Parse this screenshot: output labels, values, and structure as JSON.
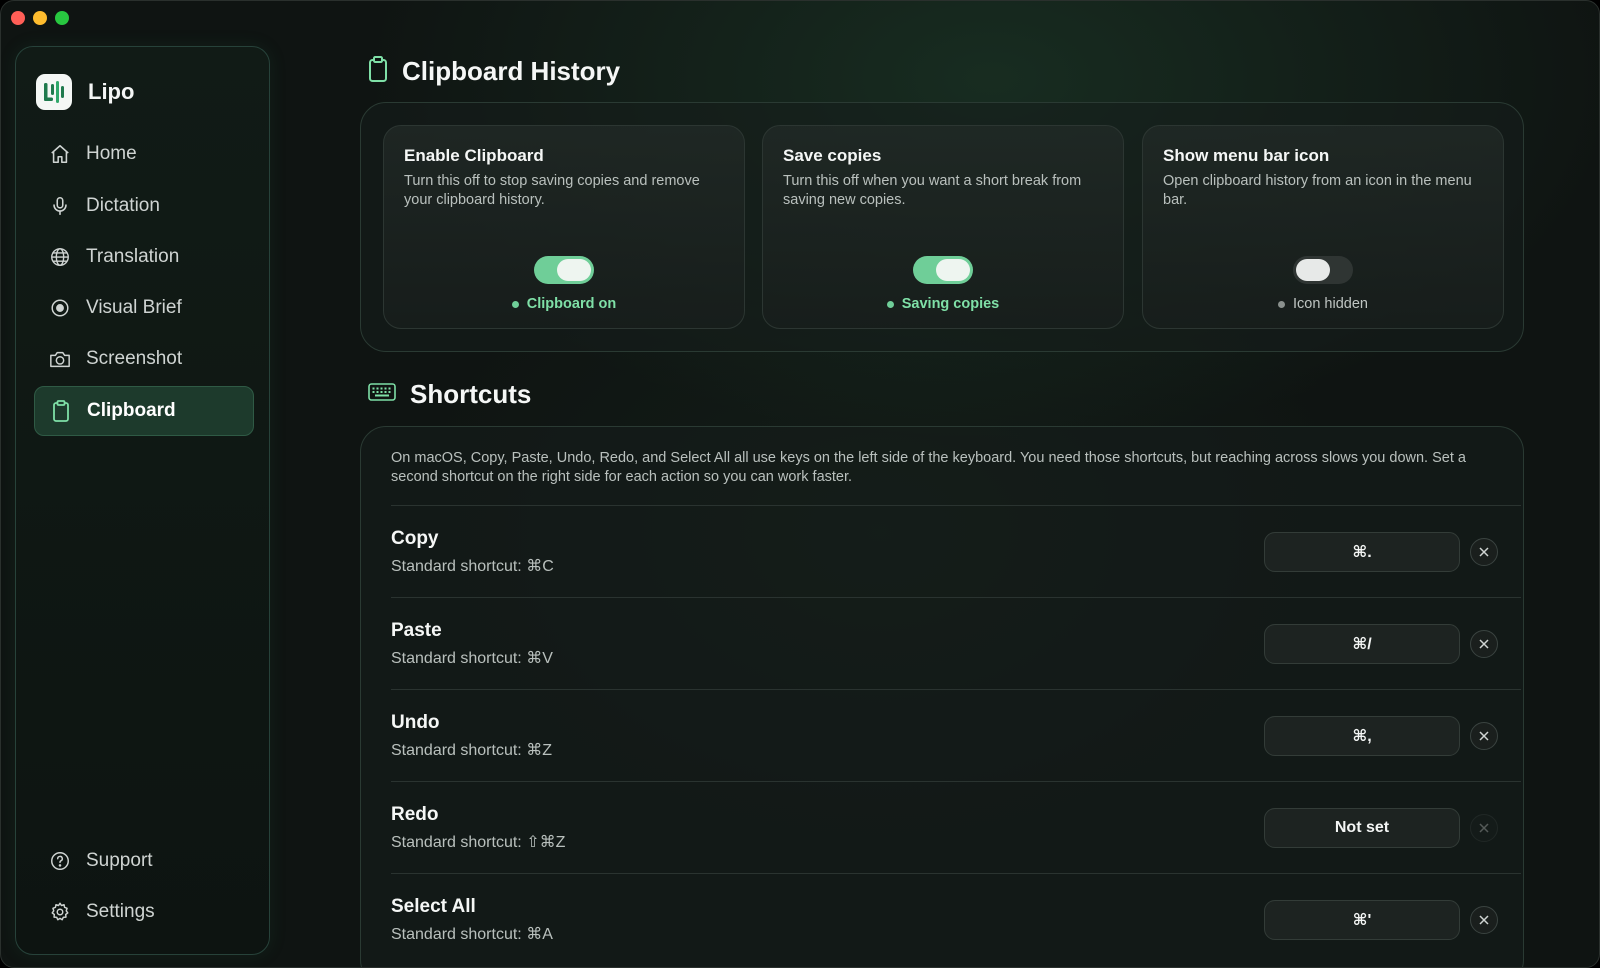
{
  "app": {
    "name": "Lipo"
  },
  "sidebar": {
    "items": [
      {
        "label": "Home",
        "icon": "home-icon"
      },
      {
        "label": "Dictation",
        "icon": "microphone-icon"
      },
      {
        "label": "Translation",
        "icon": "globe-icon"
      },
      {
        "label": "Visual Brief",
        "icon": "record-icon"
      },
      {
        "label": "Screenshot",
        "icon": "camera-icon"
      },
      {
        "label": "Clipboard",
        "icon": "clipboard-icon",
        "active": true
      }
    ],
    "footer": [
      {
        "label": "Support",
        "icon": "help-icon"
      },
      {
        "label": "Settings",
        "icon": "gear-icon"
      }
    ]
  },
  "clipboard_history": {
    "title": "Clipboard History",
    "cards": [
      {
        "title": "Enable Clipboard",
        "description": "Turn this off to stop saving copies and remove your clipboard history.",
        "enabled": true,
        "status": "Clipboard on"
      },
      {
        "title": "Save copies",
        "description": "Turn this off when you want a short break from saving new copies.",
        "enabled": true,
        "status": "Saving copies"
      },
      {
        "title": "Show menu bar icon",
        "description": "Open clipboard history from an icon in the menu bar.",
        "enabled": false,
        "status": "Icon hidden"
      }
    ]
  },
  "shortcuts": {
    "title": "Shortcuts",
    "intro": "On macOS, Copy, Paste, Undo, Redo, and Select All all use keys on the left side of the keyboard. You need those shortcuts, but reaching across slows you down. Set a second shortcut on the right side for each action so you can work faster.",
    "rows": [
      {
        "name": "Copy",
        "standard": "Standard shortcut: ⌘C",
        "custom": "⌘.",
        "clearable": true
      },
      {
        "name": "Paste",
        "standard": "Standard shortcut: ⌘V",
        "custom": "⌘/",
        "clearable": true
      },
      {
        "name": "Undo",
        "standard": "Standard shortcut: ⌘Z",
        "custom": "⌘,",
        "clearable": true
      },
      {
        "name": "Redo",
        "standard": "Standard shortcut: ⇧⌘Z",
        "custom": "Not set",
        "clearable": false
      },
      {
        "name": "Select All",
        "standard": "Standard shortcut: ⌘A",
        "custom": "⌘'",
        "clearable": true
      }
    ]
  },
  "colors": {
    "accent": "#6fce98",
    "background": "#0f1412"
  }
}
